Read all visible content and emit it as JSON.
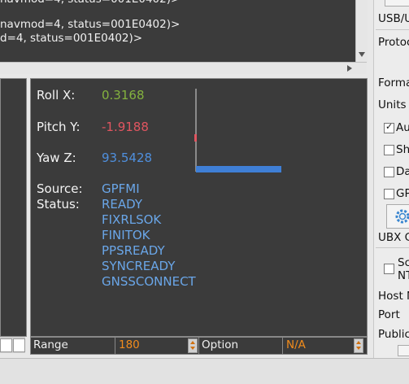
{
  "console": {
    "lines": [
      "navmod=4, status=001E0402)>",
      "navmod=4, status=001E0402)>",
      "d=4, status=001E0402)>"
    ]
  },
  "attitude": {
    "roll_label": "Roll X:",
    "roll_value": "0.3168",
    "pitch_label": "Pitch Y:",
    "pitch_value": "-1.9188",
    "yaw_label": "Yaw Z:",
    "yaw_value": "93.5428",
    "source_label": "Source:",
    "source_value": "GPFMI",
    "status_label": "Status:",
    "status_values": [
      "READY",
      "FIXRLSOK",
      "FINITOK",
      "PPSREADY",
      "SYNCREADY",
      "GNSSCONNECT"
    ],
    "colors": {
      "roll": "#84b23e",
      "pitch": "#e05560",
      "yaw": "#4f8fdd",
      "status": "#6aa6e8"
    }
  },
  "controls": {
    "range_label": "Range",
    "range_value": "180",
    "option_label": "Option",
    "option_value": "N/A"
  },
  "settings": {
    "usb_label": "USB/U",
    "protocol_label": "Protoc",
    "format_label": "Forma",
    "units_label": "Units",
    "auto_label": "Au",
    "sh_label": "Sh",
    "da_label": "Da",
    "gp_label": "GP",
    "ubx_label": "UBX C",
    "ntp_label_1": "Sc",
    "ntp_label_2": "NT",
    "host_label": "Host N",
    "port_label": "Port",
    "public_label": "Public"
  }
}
